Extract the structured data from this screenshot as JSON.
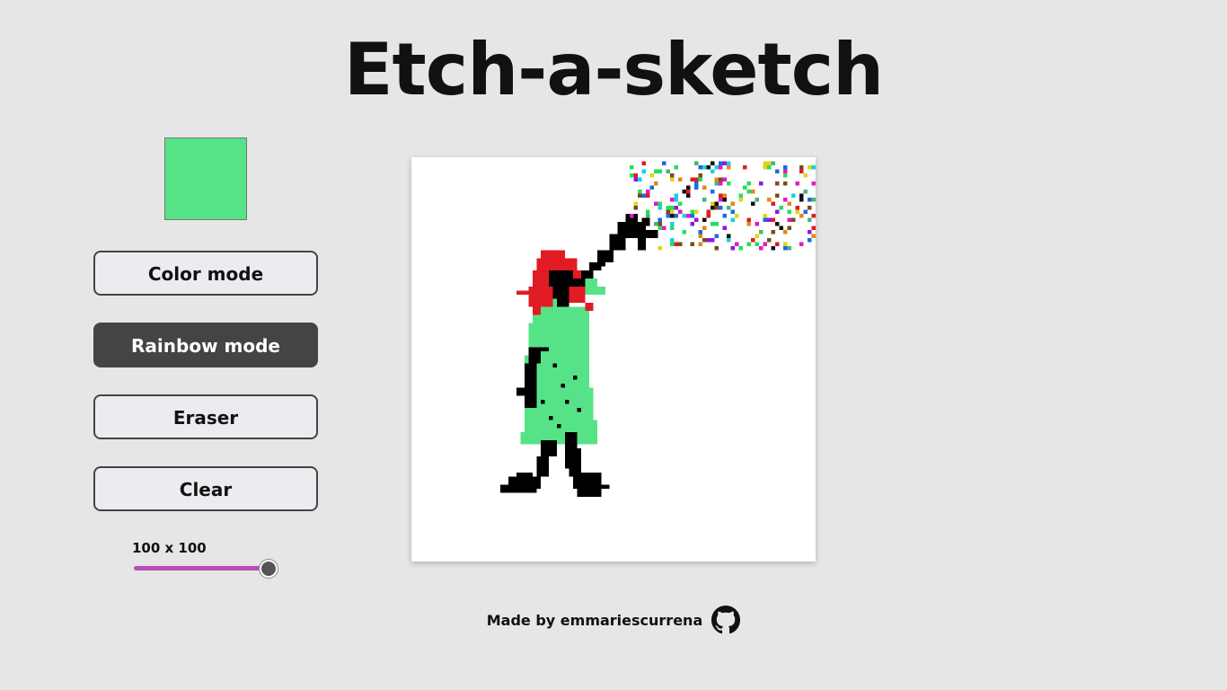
{
  "page": {
    "title": "Etch-a-sketch"
  },
  "controls": {
    "current_color": "#56e388",
    "color_mode_label": "Color mode",
    "rainbow_mode_label": "Rainbow mode",
    "eraser_label": "Eraser",
    "clear_label": "Clear",
    "active_mode": "rainbow",
    "grid_size_label": "100 x 100",
    "grid_size": 100,
    "grid_size_min": 1,
    "grid_size_max": 100
  },
  "board": {
    "background": "#ffffff",
    "colors": {
      "hair": "#e01b24",
      "dress": "#56e388",
      "outline": "#000000"
    }
  },
  "footer": {
    "made_by_text": "Made by emmariescurrena",
    "github_icon": "github-icon"
  },
  "colors": {
    "page_background": "#e6e6e6",
    "button_active_bg": "#444444",
    "slider_track": "#b84db8"
  }
}
